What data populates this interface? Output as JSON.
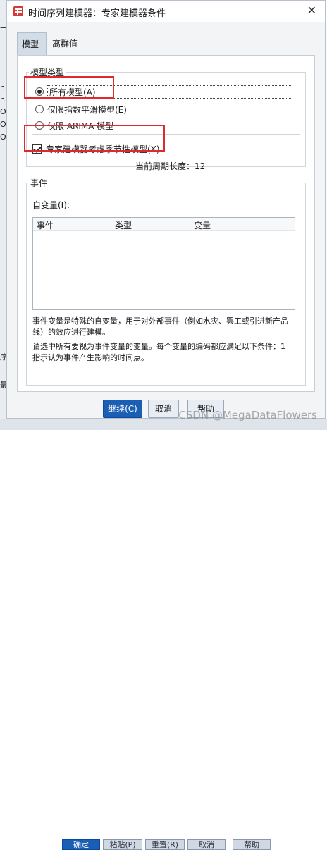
{
  "window": {
    "title": "时间序列建模器：专家建模器条件",
    "close_glyph": "✕"
  },
  "tabs": [
    {
      "label": "模型",
      "active": true
    },
    {
      "label": "离群值",
      "active": false
    }
  ],
  "model_type": {
    "legend": "模型类型",
    "options": [
      {
        "label": "所有模型(A)",
        "selected": true
      },
      {
        "label": "仅限指数平滑模型(E)",
        "selected": false
      },
      {
        "label": "仅限 ARIMA 模型",
        "selected": false
      }
    ]
  },
  "seasonal": {
    "label": "专家建模器考虑季节性模型(X)",
    "checked": true
  },
  "current_period": "当前周期长度：12",
  "events": {
    "legend": "事件",
    "variables_label": "自变量(I):",
    "columns": [
      "事件",
      "类型",
      "变量"
    ],
    "note1": "事件变量是特殊的自变量，用于对外部事件（例如水灾、罢工或引进新产品线）的效应进行建模。",
    "note2": "请选中所有要视为事件变量的变量。每个变量的编码都应满足以下条件：1 指示认为事件产生影响的时间点。"
  },
  "buttons": {
    "continue": "继续(C)",
    "cancel": "取消",
    "help": "帮助"
  },
  "background": {
    "left_fragments": [
      "十",
      "n",
      "n",
      "O",
      "O",
      "O",
      "序",
      "最"
    ],
    "bottom_buttons": [
      "确定",
      "粘贴(P)",
      "重置(R)",
      "取消",
      "帮助"
    ]
  },
  "watermark": "CSDN @MegaDataFlowers",
  "icons": {
    "app": "app-window-icon",
    "close": "close-icon"
  },
  "colors": {
    "accent": "#1a5fb4",
    "highlight_box": "#e0282d"
  }
}
